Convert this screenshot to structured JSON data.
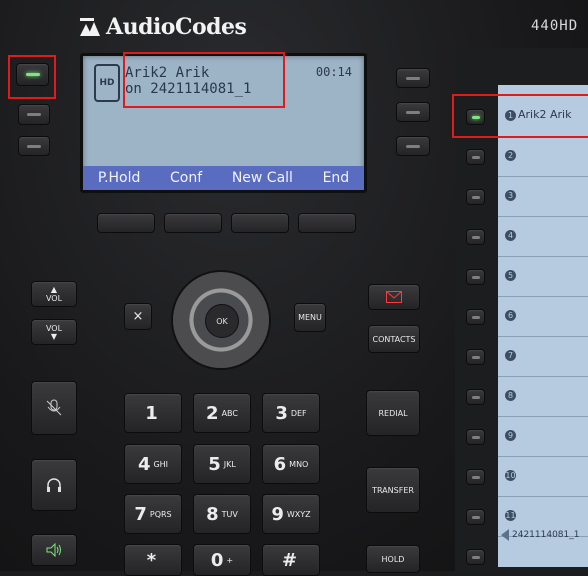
{
  "brand": {
    "name": "AudioCodes",
    "model": "440HD"
  },
  "display": {
    "hd_badge": "HD",
    "caller_name": "Arik2 Arik",
    "caller_number": "on 2421114081_1",
    "timer": "00:14",
    "softkeys": [
      "P.Hold",
      "Conf",
      "New Call",
      "End"
    ]
  },
  "keys": {
    "vol_up": "VOL",
    "vol_down": "VOL",
    "cancel": "×",
    "ok": "OK",
    "menu": "MENU",
    "message_icon": "envelope-icon",
    "contacts": "CONTACTS",
    "redial": "REDIAL",
    "transfer": "TRANSFER",
    "hold": "HOLD",
    "dialpad": [
      {
        "digit": "1",
        "letters": ""
      },
      {
        "digit": "2",
        "letters": "ABC"
      },
      {
        "digit": "3",
        "letters": "DEF"
      },
      {
        "digit": "4",
        "letters": "GHI"
      },
      {
        "digit": "5",
        "letters": "JKL"
      },
      {
        "digit": "6",
        "letters": "MNO"
      },
      {
        "digit": "7",
        "letters": "PQRS"
      },
      {
        "digit": "8",
        "letters": "TUV"
      },
      {
        "digit": "9",
        "letters": "WXYZ"
      },
      {
        "digit": "*",
        "letters": ""
      },
      {
        "digit": "0",
        "letters": "+"
      },
      {
        "digit": "#",
        "letters": ""
      }
    ]
  },
  "sidecar": {
    "slots": [
      {
        "num": "1",
        "label": "Arik2 Arik"
      },
      {
        "num": "2",
        "label": ""
      },
      {
        "num": "3",
        "label": ""
      },
      {
        "num": "4",
        "label": ""
      },
      {
        "num": "5",
        "label": ""
      },
      {
        "num": "6",
        "label": ""
      },
      {
        "num": "7",
        "label": ""
      },
      {
        "num": "8",
        "label": ""
      },
      {
        "num": "9",
        "label": ""
      },
      {
        "num": "10",
        "label": ""
      },
      {
        "num": "11",
        "label": ""
      }
    ],
    "footer": "2421114081_1"
  },
  "colors": {
    "highlight": "#e01b1b",
    "lcd": "#9db3c6",
    "softbar": "#5a6cc0",
    "led_active": "#7ee67e",
    "sidecar_screen": "#b6cbe0"
  }
}
